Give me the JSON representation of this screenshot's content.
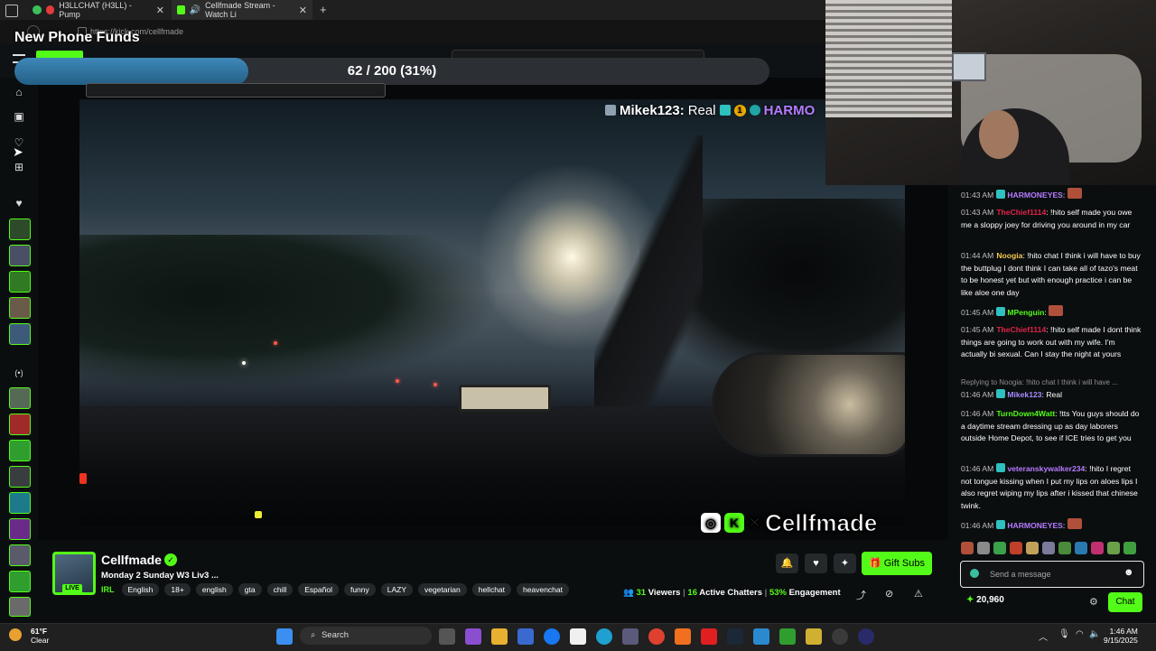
{
  "browser": {
    "tabs": [
      {
        "label": "H3LLCHAT (H3LL) - Pump",
        "icon": "pump-icon"
      },
      {
        "label": "Cellfmade Stream - Watch Li",
        "icon": "kick-icon"
      }
    ],
    "url": "https://kick.com/cellfmade"
  },
  "overlay": {
    "title": "New Phone Funds",
    "progress_text": "62 / 200 (31%)",
    "progress_fraction": 0.31,
    "progress_color": "#2f74a3"
  },
  "video": {
    "ticker_user": "Mikek123:",
    "ticker_msg": "Real",
    "ticker_next": "HARMO",
    "watermark": "Cellfmade"
  },
  "stream": {
    "channel_name": "Cellfmade",
    "title": "Monday 2 Sunday W3 Liv3 ...",
    "live_label": "LIVE",
    "category": "IRL",
    "tags": [
      "English",
      "18+",
      "english",
      "gta",
      "chill",
      "Español",
      "funny",
      "LAZY",
      "vegetarian",
      "hellchat",
      "heavenchat"
    ],
    "gift_button": "Gift Subs",
    "viewers": "31",
    "viewers_label": "Viewers",
    "chatters": "16",
    "chatters_label": "Active Chatters",
    "engagement": "53%",
    "engagement_label": "Engagement",
    "separator": "|"
  },
  "chat": {
    "messages": [
      {
        "time": "01:43 AM",
        "user": "HARMONEYES",
        "color": "#b57bff",
        "text": ""
      },
      {
        "time": "01:43 AM",
        "user": "TheChief1114",
        "color": "#e0244a",
        "text": "!hito self made you owe me a sloppy joey for driving you around in my car"
      },
      {
        "time": "01:44 AM",
        "user": "Noogia",
        "color": "#f2c94c",
        "text": "!hito chat I think i will have to buy the buttplug I dont think I can take all of tazo's meat to be honest yet but with enough practice i can be like aloe one day"
      },
      {
        "time": "01:45 AM",
        "user": "MPenguin",
        "color": "#53fc18",
        "text": ""
      },
      {
        "time": "01:45 AM",
        "user": "TheChief1114",
        "color": "#e0244a",
        "text": "!hito self made I dont think things are going to work out with my wife. I'm actually bi sexual. Can I stay the night at yours"
      },
      {
        "time": "01:46 AM",
        "user": "Mikek123",
        "color": "#a58bff",
        "text": "Real"
      },
      {
        "time": "01:46 AM",
        "user": "TurnDown4Watt",
        "color": "#53fc18",
        "text": "!tts You guys should do a daytime stream dressing up as day laborers outside Home Depot, to see if ICE tries to get you"
      },
      {
        "time": "01:46 AM",
        "user": "veteranskywalker234",
        "color": "#b57bff",
        "text": "!hito I regret not tongue kissing when I put my lips on aloes lips I also regret wiping my lips after i kissed that chinese twink."
      },
      {
        "time": "01:46 AM",
        "user": "HARMONEYES",
        "color": "#b57bff",
        "text": ""
      }
    ],
    "reply_note": "Replying to Noogia: !hito chat I think i will have ...",
    "input_placeholder": "Send a message",
    "points": "20,960",
    "chat_button": "Chat"
  },
  "taskbar": {
    "weather_temp": "61°F",
    "weather_desc": "Clear",
    "search_label": "Search",
    "time": "1:46 AM",
    "date": "9/15/2025"
  },
  "colors": {
    "accent": "#53fc18",
    "background": "#0b0e0f"
  }
}
